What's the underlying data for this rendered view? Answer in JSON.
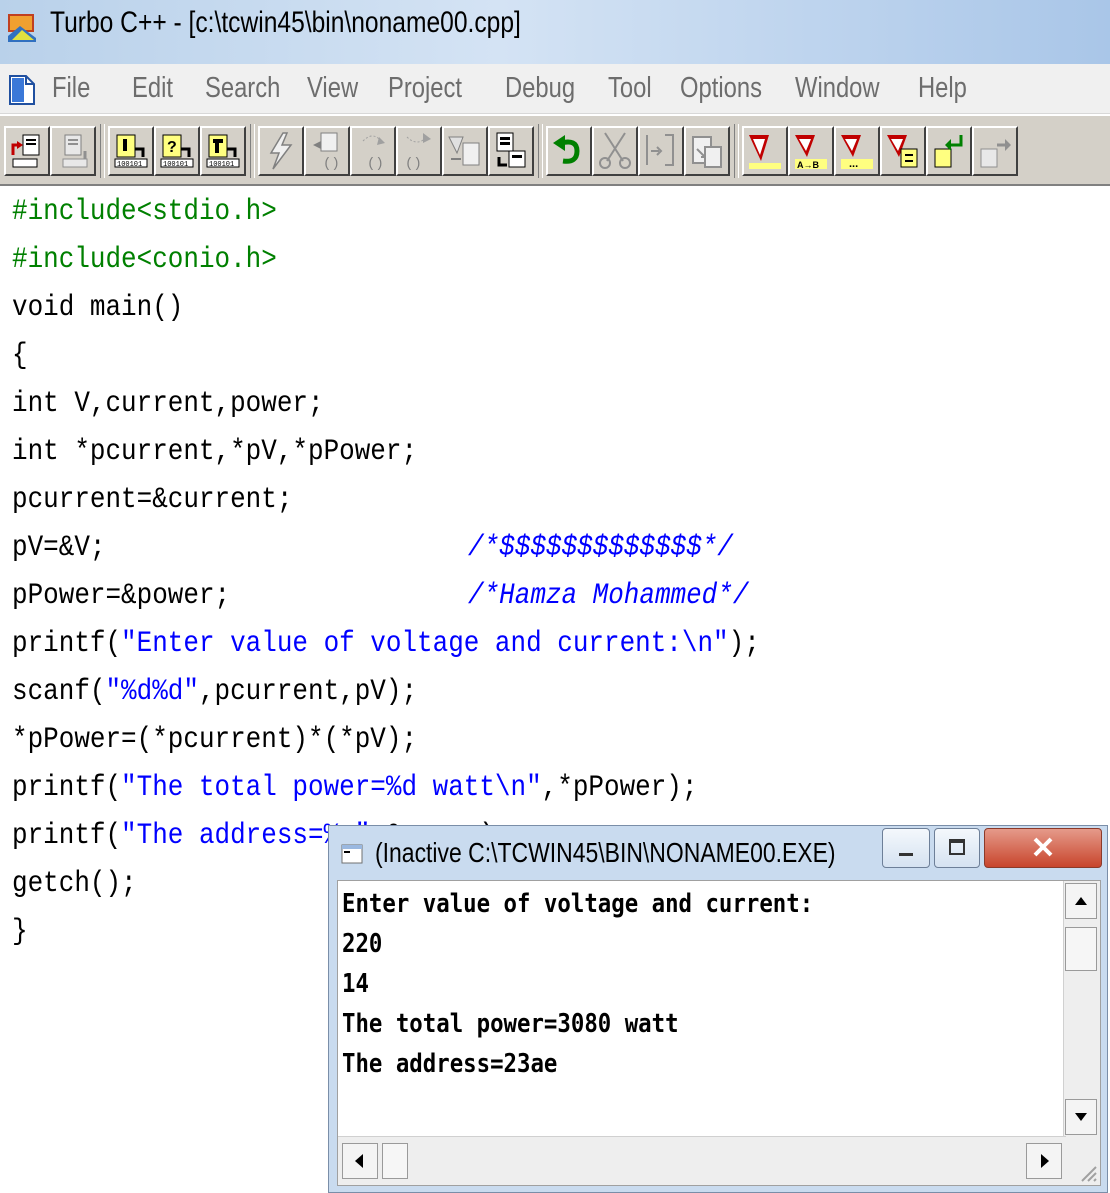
{
  "window": {
    "title": "Turbo C++ - [c:\\tcwin45\\bin\\noname00.cpp]"
  },
  "menu": [
    "File",
    "Edit",
    "Search",
    "View",
    "Project",
    "Debug",
    "Tool",
    "Options",
    "Window",
    "Help"
  ],
  "toolbar": {
    "buttons": [
      "open-file-icon",
      "save-file-icon",
      "compile-icon",
      "make-icon",
      "build-icon",
      "run-icon",
      "step-over-icon",
      "trace-into-icon",
      "go-to-cursor-icon",
      "program-reset-icon",
      "undo-icon",
      "cut-icon",
      "copy-icon",
      "paste-icon",
      "search-icon",
      "replace-icon",
      "search-again-icon",
      "browse-icon",
      "next-message-icon"
    ]
  },
  "code": {
    "lines": [
      "#include<stdio.h>",
      "#include<conio.h>",
      "void main()",
      "{",
      "int V,current,power;",
      "int *pcurrent,*pV,*pPower;",
      "pcurrent=&current;",
      "pV=&V;",
      "pPower=&power;",
      "printf(",
      "scanf(",
      "*pPower=(*pcurrent)*(*pV);",
      "printf(",
      "printf(",
      "getch();",
      "}"
    ],
    "comment1": "/*$$$$$$$$$$$$$*/",
    "comment2": "/*Hamza Mohammed*/",
    "str1": "\"Enter value of voltage and current:\\n\"",
    "tail1": ");",
    "str2": "\"%d%d\"",
    "tail2": ",pcurrent,pV);",
    "str3": "\"The total power=%d watt\\n\"",
    "tail3": ",*pPower);",
    "str4": "\"The address=%x\"",
    "tail4": ",&power);"
  },
  "console": {
    "title": "(Inactive C:\\TCWIN45\\BIN\\NONAME00.EXE)",
    "output": [
      "Enter value of voltage and current:",
      "220",
      "14",
      "The total power=3080 watt",
      "The address=23ae"
    ]
  }
}
